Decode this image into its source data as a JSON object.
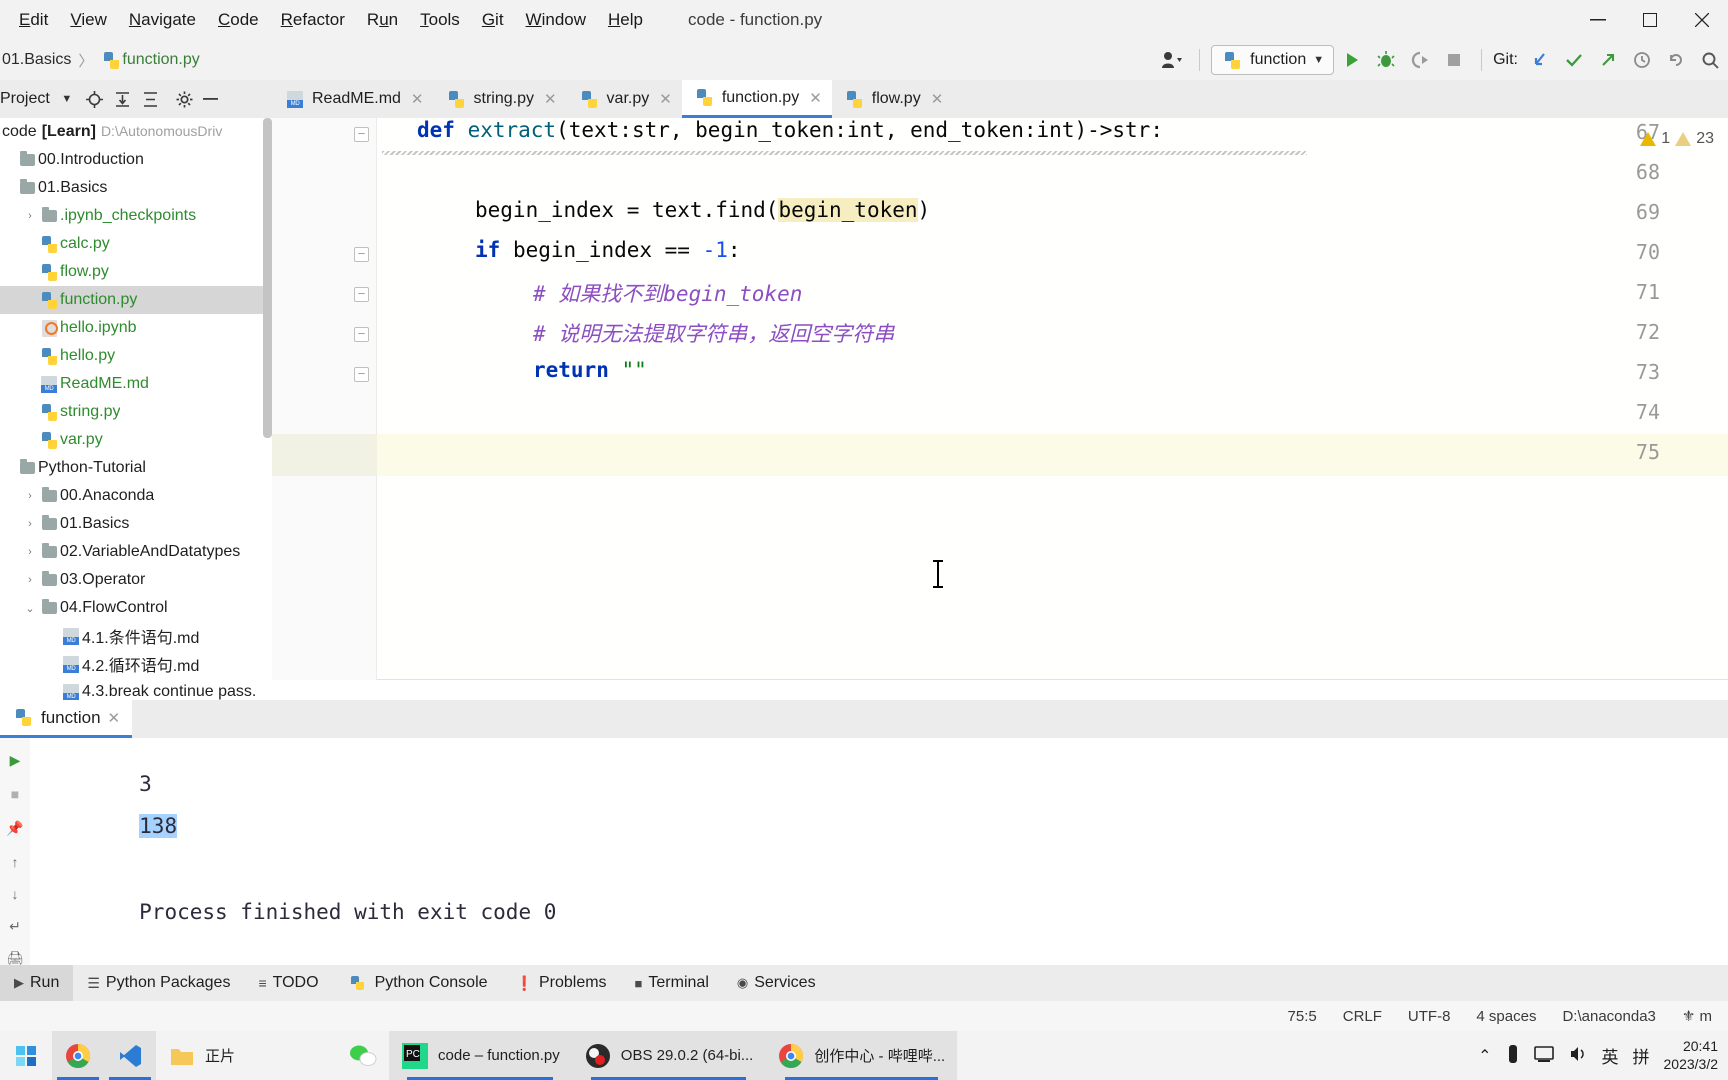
{
  "window": {
    "title": "code - function.py",
    "minimize": "—",
    "maximize": "☐",
    "close": "✕"
  },
  "menubar": {
    "items": [
      {
        "label": "Edit",
        "mnemonic": "E"
      },
      {
        "label": "View",
        "mnemonic": "V"
      },
      {
        "label": "Navigate",
        "mnemonic": "N"
      },
      {
        "label": "Code",
        "mnemonic": "C"
      },
      {
        "label": "Refactor",
        "mnemonic": "R"
      },
      {
        "label": "Run",
        "mnemonic": "u"
      },
      {
        "label": "Tools",
        "mnemonic": "T"
      },
      {
        "label": "Git",
        "mnemonic": "G"
      },
      {
        "label": "Window",
        "mnemonic": "W"
      },
      {
        "label": "Help",
        "mnemonic": "H"
      }
    ]
  },
  "navbar": {
    "breadcrumb": [
      "1.Basics",
      "function.py"
    ],
    "separator": "〉",
    "run_config": "function",
    "git_label": "Git:",
    "account_icon": "account-icon",
    "run_icon": "run-icon",
    "debug_icon": "debug-icon",
    "coverage_icon": "coverage-icon",
    "stop_icon": "stop-icon",
    "update_project_icon": "update-project-icon",
    "commit_icon": "commit-icon",
    "push_icon": "push-icon",
    "history_icon": "history-icon",
    "rollback_icon": "rollback-icon",
    "search_icon": "search-icon"
  },
  "tool_window": {
    "title": "Project",
    "dropdown_icon": "chevron-down-icon",
    "locate_icon": "locate-icon",
    "expand_all_icon": "expand-all-icon",
    "collapse_all_icon": "collapse-all-icon",
    "settings_icon": "gear-icon",
    "hide_icon": "minimize-icon"
  },
  "editor_tabs": [
    {
      "label": "ReadME.md",
      "icon": "md-file-icon",
      "active": false
    },
    {
      "label": "string.py",
      "icon": "py-file-icon",
      "active": false
    },
    {
      "label": "var.py",
      "icon": "py-file-icon",
      "active": false
    },
    {
      "label": "function.py",
      "icon": "py-file-icon",
      "active": true
    },
    {
      "label": "flow.py",
      "icon": "py-file-icon",
      "active": false
    }
  ],
  "project_tree": {
    "root": {
      "name": "code",
      "scope": "[Learn]",
      "path": "D:\\AutonomousDriv"
    },
    "items": [
      {
        "label": "00.Introduction",
        "type": "folder",
        "indent": 0,
        "arrow": "",
        "selected": false,
        "green": false
      },
      {
        "label": "01.Basics",
        "type": "folder",
        "indent": 0,
        "arrow": "",
        "selected": false,
        "green": false
      },
      {
        "label": ".ipynb_checkpoints",
        "type": "folder",
        "indent": 1,
        "arrow": "›",
        "selected": false,
        "green": true
      },
      {
        "label": "calc.py",
        "type": "py",
        "indent": 1,
        "arrow": "",
        "selected": false,
        "green": true
      },
      {
        "label": "flow.py",
        "type": "py",
        "indent": 1,
        "arrow": "",
        "selected": false,
        "green": true
      },
      {
        "label": "function.py",
        "type": "py",
        "indent": 1,
        "arrow": "",
        "selected": true,
        "green": true
      },
      {
        "label": "hello.ipynb",
        "type": "ipynb",
        "indent": 1,
        "arrow": "",
        "selected": false,
        "green": true
      },
      {
        "label": "hello.py",
        "type": "py",
        "indent": 1,
        "arrow": "",
        "selected": false,
        "green": true
      },
      {
        "label": "ReadME.md",
        "type": "md",
        "indent": 1,
        "arrow": "",
        "selected": false,
        "green": true
      },
      {
        "label": "string.py",
        "type": "py",
        "indent": 1,
        "arrow": "",
        "selected": false,
        "green": true
      },
      {
        "label": "var.py",
        "type": "py",
        "indent": 1,
        "arrow": "",
        "selected": false,
        "green": true
      },
      {
        "label": "Python-Tutorial",
        "type": "folder",
        "indent": 0,
        "arrow": "",
        "selected": false,
        "green": false
      },
      {
        "label": "00.Anaconda",
        "type": "folder",
        "indent": 1,
        "arrow": "›",
        "selected": false,
        "green": false
      },
      {
        "label": "01.Basics",
        "type": "folder",
        "indent": 1,
        "arrow": "›",
        "selected": false,
        "green": false
      },
      {
        "label": "02.VariableAndDatatypes",
        "type": "folder",
        "indent": 1,
        "arrow": "›",
        "selected": false,
        "green": false
      },
      {
        "label": "03.Operator",
        "type": "folder",
        "indent": 1,
        "arrow": "›",
        "selected": false,
        "green": false
      },
      {
        "label": "04.FlowControl",
        "type": "folder",
        "indent": 1,
        "arrow": "⌄",
        "selected": false,
        "green": false
      },
      {
        "label": "4.1.条件语句.md",
        "type": "md",
        "indent": 2,
        "arrow": "",
        "selected": false,
        "green": false
      },
      {
        "label": "4.2.循环语句.md",
        "type": "md",
        "indent": 2,
        "arrow": "",
        "selected": false,
        "green": false
      },
      {
        "label": "4.3.break continue pass.",
        "type": "md",
        "indent": 2,
        "arrow": "",
        "selected": false,
        "green": false
      }
    ]
  },
  "editor": {
    "first_visible_line": 67,
    "lines": [
      {
        "num": 67,
        "fold": "−",
        "indent": 0,
        "tokens": [
          {
            "t": "def ",
            "c": "kw"
          },
          {
            "t": "extract",
            "c": "fn"
          },
          {
            "t": "(text:str, begin_token:int, end_token:int)->str:",
            "c": ""
          }
        ]
      },
      {
        "num": 68,
        "fold": "",
        "indent": 0,
        "tokens": []
      },
      {
        "num": 69,
        "fold": "",
        "indent": 1,
        "tokens": [
          {
            "t": "begin_index = text.find(",
            "c": ""
          },
          {
            "t": "begin_token",
            "c": "hlmatch"
          },
          {
            "t": ")",
            "c": ""
          }
        ]
      },
      {
        "num": 70,
        "fold": "−",
        "indent": 1,
        "tokens": [
          {
            "t": "if ",
            "c": "kw"
          },
          {
            "t": "begin_index == ",
            "c": ""
          },
          {
            "t": "-1",
            "c": "num"
          },
          {
            "t": ":",
            "c": ""
          }
        ]
      },
      {
        "num": 71,
        "fold": "−",
        "indent": 2,
        "tokens": [
          {
            "t": "# 如果找不到begin_token",
            "c": "cmt"
          }
        ]
      },
      {
        "num": 72,
        "fold": "−",
        "indent": 2,
        "tokens": [
          {
            "t": "# 说明无法提取字符串，返回空字符串",
            "c": "cmt"
          }
        ]
      },
      {
        "num": 73,
        "fold": "−",
        "indent": 2,
        "tokens": [
          {
            "t": "return ",
            "c": "kw"
          },
          {
            "t": "\"\"",
            "c": "str"
          }
        ]
      },
      {
        "num": 74,
        "fold": "",
        "indent": 0,
        "tokens": []
      },
      {
        "num": 75,
        "fold": "",
        "indent": 1,
        "tokens": [],
        "current": true
      }
    ],
    "inspection": {
      "warnings_typo": "1",
      "warnings_weak": "23",
      "typo_icon": "warning-icon",
      "weak-icon": "weak-warning-icon"
    }
  },
  "run_panel": {
    "tab_label": "function",
    "tab_icon": "python-icon",
    "close_icon": "close-icon",
    "side_icons": [
      "rerun-icon",
      "stop-icon",
      "pin-icon",
      "up-icon",
      "down-icon",
      "soft-wrap-icon",
      "print-icon",
      "clear-icon"
    ],
    "output": [
      {
        "text": "3",
        "selected": false
      },
      {
        "text": "138",
        "selected": true
      },
      {
        "text": "",
        "selected": false
      },
      {
        "text": "Process finished with exit code 0",
        "selected": false
      }
    ]
  },
  "bottom_toolbar": {
    "items": [
      {
        "label": "Run",
        "icon": "run-icon",
        "active": true
      },
      {
        "label": "Python Packages",
        "icon": "packages-icon",
        "active": false
      },
      {
        "label": "TODO",
        "icon": "todo-icon",
        "active": false
      },
      {
        "label": "Python Console",
        "icon": "python-icon",
        "active": false
      },
      {
        "label": "Problems",
        "icon": "problems-icon",
        "active": false
      },
      {
        "label": "Terminal",
        "icon": "terminal-icon",
        "active": false
      },
      {
        "label": "Services",
        "icon": "services-icon",
        "active": false
      }
    ]
  },
  "statusbar": {
    "caret": "75:5",
    "line_sep": "CRLF",
    "encoding": "UTF-8",
    "indent": "4 spaces",
    "interpreter": "D:\\anaconda3",
    "branch_icon": "git-branch-icon"
  },
  "taskbar": {
    "apps": [
      {
        "label": "",
        "icon": "start-icon",
        "running": false
      },
      {
        "label": "",
        "icon": "chrome-icon",
        "running": true
      },
      {
        "label": "",
        "icon": "vscode-icon",
        "running": true
      },
      {
        "label": "正片",
        "icon": "folder-icon",
        "running": false
      },
      {
        "label": "",
        "icon": "wechat-icon",
        "running": false
      },
      {
        "label": "code – function.py",
        "icon": "pycharm-icon",
        "running": true
      },
      {
        "label": "OBS 29.0.2 (64-bi...",
        "icon": "obs-icon",
        "running": true
      },
      {
        "label": "创作中心 - 哔哩哔...",
        "icon": "chrome-icon",
        "running": true
      }
    ],
    "tray": {
      "chevron": "⌃",
      "battery_icon": "battery-icon",
      "monitor_icon": "monitor-icon",
      "volume_icon": "volume-icon",
      "ime_lang": "英",
      "ime_mode": "拼",
      "time": "20:41",
      "date": "2023/3/2"
    }
  }
}
